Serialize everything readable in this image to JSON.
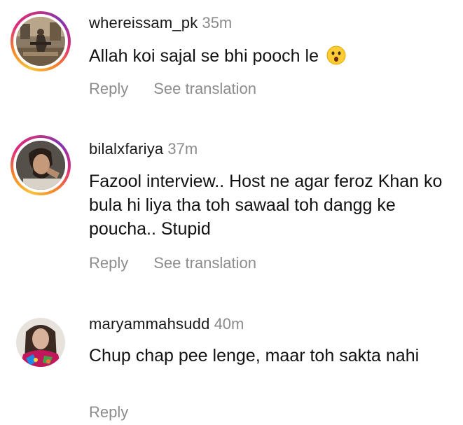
{
  "comments": [
    {
      "username": "whereissam_pk",
      "time": "35m",
      "text": "Allah koi sajal se bhi pooch le",
      "emoji_icon": "astonished-face-emoji",
      "reply_label": "Reply",
      "translate_label": "See translation",
      "has_story_ring": true
    },
    {
      "username": "bilalxfariya",
      "time": "37m",
      "text": "Fazool interview.. Host ne agar feroz Khan ko bula hi liya tha toh sawaal toh dangg ke poucha.. Stupid",
      "reply_label": "Reply",
      "translate_label": "See translation",
      "has_story_ring": true
    },
    {
      "username": "maryammahsudd",
      "time": "40m",
      "text": "Chup chap pee lenge, maar toh sakta nahi",
      "reply_label": "Reply",
      "has_story_ring": false
    }
  ],
  "colors": {
    "username": "#1a1a1a",
    "timestamp": "#8a8a8a",
    "action_text": "#8c8c8c",
    "story_ring_start": "#f9c33a",
    "story_ring_end": "#c13584"
  }
}
